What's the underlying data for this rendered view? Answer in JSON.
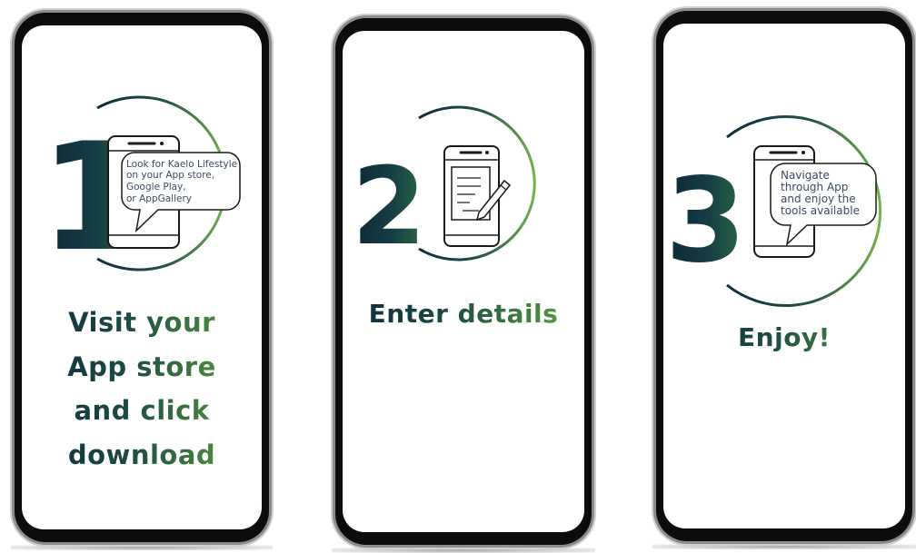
{
  "steps": [
    {
      "number": "1",
      "bubble_lines": [
        "Look for Kaelo Lifestyle",
        "on your App store,",
        "Google Play,",
        "or AppGallery"
      ],
      "caption_lines": [
        "Visit your",
        "App store",
        "and click",
        "download"
      ],
      "icon": "phone-speech-bubble-icon"
    },
    {
      "number": "2",
      "caption_lines": [
        "Enter details"
      ],
      "icon": "phone-document-pen-icon"
    },
    {
      "number": "3",
      "bubble_lines": [
        "Navigate",
        "through App",
        "and enjoy the",
        "tools available"
      ],
      "caption_lines": [
        "Enjoy!"
      ],
      "icon": "phone-speech-bubble-icon"
    }
  ],
  "colors": {
    "navy": "#0e2b3a",
    "green": "#66a845",
    "text": "#3c4a63",
    "frame": "#0c0c0c"
  }
}
